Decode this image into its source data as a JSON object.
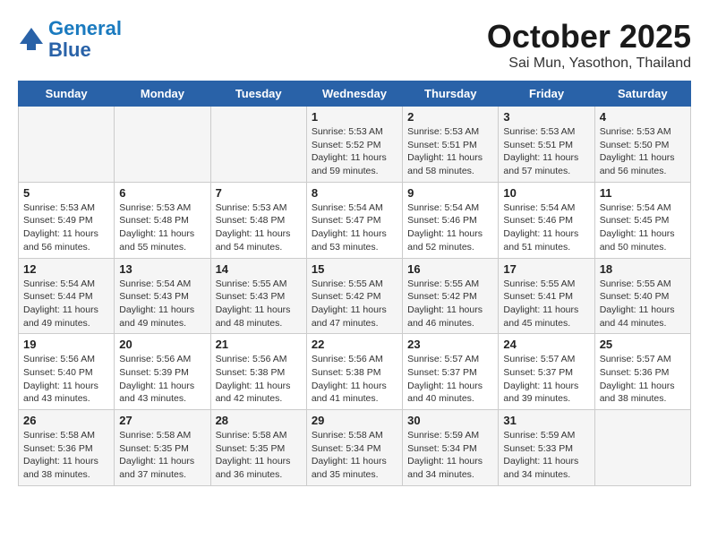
{
  "header": {
    "logo_line1": "General",
    "logo_line2": "Blue",
    "title": "October 2025",
    "subtitle": "Sai Mun, Yasothon, Thailand"
  },
  "days_of_week": [
    "Sunday",
    "Monday",
    "Tuesday",
    "Wednesday",
    "Thursday",
    "Friday",
    "Saturday"
  ],
  "weeks": [
    [
      {
        "day": "",
        "info": ""
      },
      {
        "day": "",
        "info": ""
      },
      {
        "day": "",
        "info": ""
      },
      {
        "day": "1",
        "info": "Sunrise: 5:53 AM\nSunset: 5:52 PM\nDaylight: 11 hours\nand 59 minutes."
      },
      {
        "day": "2",
        "info": "Sunrise: 5:53 AM\nSunset: 5:51 PM\nDaylight: 11 hours\nand 58 minutes."
      },
      {
        "day": "3",
        "info": "Sunrise: 5:53 AM\nSunset: 5:51 PM\nDaylight: 11 hours\nand 57 minutes."
      },
      {
        "day": "4",
        "info": "Sunrise: 5:53 AM\nSunset: 5:50 PM\nDaylight: 11 hours\nand 56 minutes."
      }
    ],
    [
      {
        "day": "5",
        "info": "Sunrise: 5:53 AM\nSunset: 5:49 PM\nDaylight: 11 hours\nand 56 minutes."
      },
      {
        "day": "6",
        "info": "Sunrise: 5:53 AM\nSunset: 5:48 PM\nDaylight: 11 hours\nand 55 minutes."
      },
      {
        "day": "7",
        "info": "Sunrise: 5:53 AM\nSunset: 5:48 PM\nDaylight: 11 hours\nand 54 minutes."
      },
      {
        "day": "8",
        "info": "Sunrise: 5:54 AM\nSunset: 5:47 PM\nDaylight: 11 hours\nand 53 minutes."
      },
      {
        "day": "9",
        "info": "Sunrise: 5:54 AM\nSunset: 5:46 PM\nDaylight: 11 hours\nand 52 minutes."
      },
      {
        "day": "10",
        "info": "Sunrise: 5:54 AM\nSunset: 5:46 PM\nDaylight: 11 hours\nand 51 minutes."
      },
      {
        "day": "11",
        "info": "Sunrise: 5:54 AM\nSunset: 5:45 PM\nDaylight: 11 hours\nand 50 minutes."
      }
    ],
    [
      {
        "day": "12",
        "info": "Sunrise: 5:54 AM\nSunset: 5:44 PM\nDaylight: 11 hours\nand 49 minutes."
      },
      {
        "day": "13",
        "info": "Sunrise: 5:54 AM\nSunset: 5:43 PM\nDaylight: 11 hours\nand 49 minutes."
      },
      {
        "day": "14",
        "info": "Sunrise: 5:55 AM\nSunset: 5:43 PM\nDaylight: 11 hours\nand 48 minutes."
      },
      {
        "day": "15",
        "info": "Sunrise: 5:55 AM\nSunset: 5:42 PM\nDaylight: 11 hours\nand 47 minutes."
      },
      {
        "day": "16",
        "info": "Sunrise: 5:55 AM\nSunset: 5:42 PM\nDaylight: 11 hours\nand 46 minutes."
      },
      {
        "day": "17",
        "info": "Sunrise: 5:55 AM\nSunset: 5:41 PM\nDaylight: 11 hours\nand 45 minutes."
      },
      {
        "day": "18",
        "info": "Sunrise: 5:55 AM\nSunset: 5:40 PM\nDaylight: 11 hours\nand 44 minutes."
      }
    ],
    [
      {
        "day": "19",
        "info": "Sunrise: 5:56 AM\nSunset: 5:40 PM\nDaylight: 11 hours\nand 43 minutes."
      },
      {
        "day": "20",
        "info": "Sunrise: 5:56 AM\nSunset: 5:39 PM\nDaylight: 11 hours\nand 43 minutes."
      },
      {
        "day": "21",
        "info": "Sunrise: 5:56 AM\nSunset: 5:38 PM\nDaylight: 11 hours\nand 42 minutes."
      },
      {
        "day": "22",
        "info": "Sunrise: 5:56 AM\nSunset: 5:38 PM\nDaylight: 11 hours\nand 41 minutes."
      },
      {
        "day": "23",
        "info": "Sunrise: 5:57 AM\nSunset: 5:37 PM\nDaylight: 11 hours\nand 40 minutes."
      },
      {
        "day": "24",
        "info": "Sunrise: 5:57 AM\nSunset: 5:37 PM\nDaylight: 11 hours\nand 39 minutes."
      },
      {
        "day": "25",
        "info": "Sunrise: 5:57 AM\nSunset: 5:36 PM\nDaylight: 11 hours\nand 38 minutes."
      }
    ],
    [
      {
        "day": "26",
        "info": "Sunrise: 5:58 AM\nSunset: 5:36 PM\nDaylight: 11 hours\nand 38 minutes."
      },
      {
        "day": "27",
        "info": "Sunrise: 5:58 AM\nSunset: 5:35 PM\nDaylight: 11 hours\nand 37 minutes."
      },
      {
        "day": "28",
        "info": "Sunrise: 5:58 AM\nSunset: 5:35 PM\nDaylight: 11 hours\nand 36 minutes."
      },
      {
        "day": "29",
        "info": "Sunrise: 5:58 AM\nSunset: 5:34 PM\nDaylight: 11 hours\nand 35 minutes."
      },
      {
        "day": "30",
        "info": "Sunrise: 5:59 AM\nSunset: 5:34 PM\nDaylight: 11 hours\nand 34 minutes."
      },
      {
        "day": "31",
        "info": "Sunrise: 5:59 AM\nSunset: 5:33 PM\nDaylight: 11 hours\nand 34 minutes."
      },
      {
        "day": "",
        "info": ""
      }
    ]
  ]
}
